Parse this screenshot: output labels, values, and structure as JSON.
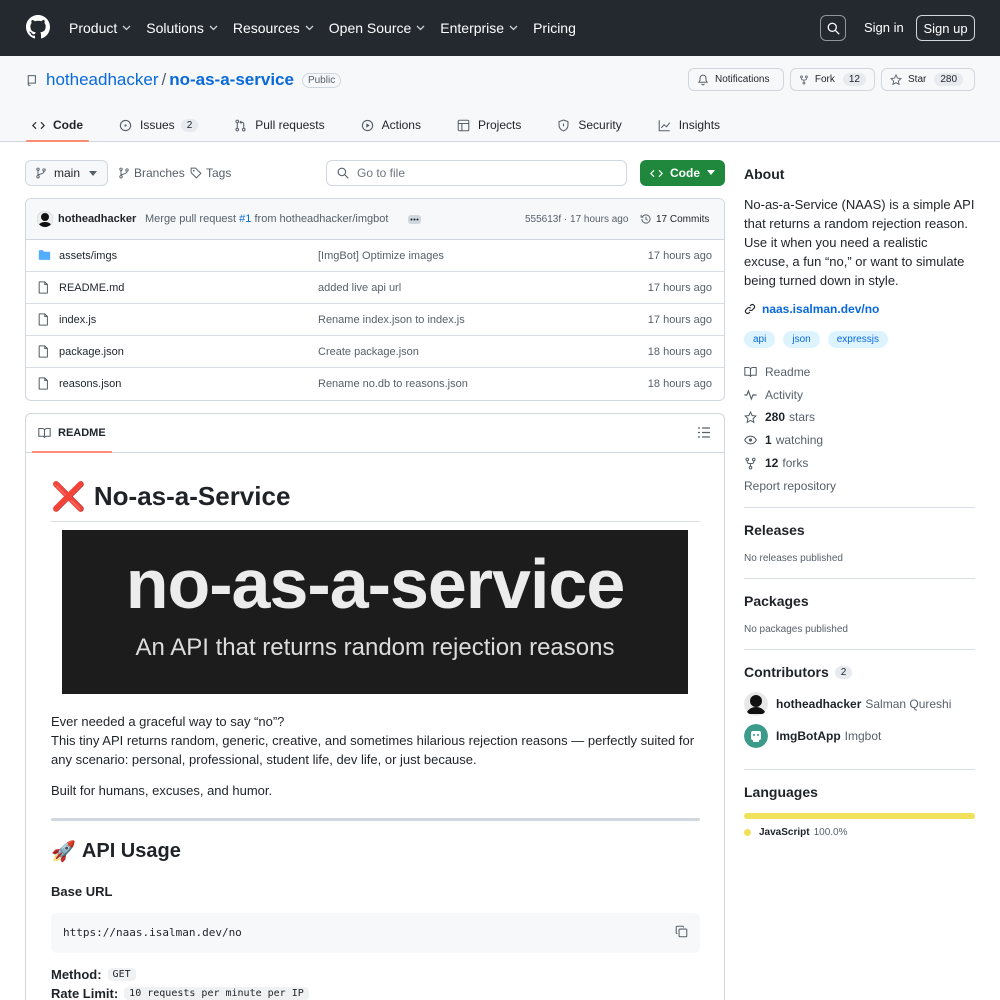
{
  "header": {
    "nav": [
      "Product",
      "Solutions",
      "Resources",
      "Open Source",
      "Enterprise",
      "Pricing"
    ],
    "signin": "Sign in",
    "signup": "Sign up"
  },
  "repo": {
    "owner": "hotheadhacker",
    "name": "no-as-a-service",
    "visibility": "Public",
    "notifications_label": "Notifications",
    "fork_label": "Fork",
    "fork_count": "12",
    "star_label": "Star",
    "star_count": "280",
    "tabs": [
      {
        "label": "Code",
        "count": ""
      },
      {
        "label": "Issues",
        "count": "2"
      },
      {
        "label": "Pull requests",
        "count": ""
      },
      {
        "label": "Actions",
        "count": ""
      },
      {
        "label": "Projects",
        "count": ""
      },
      {
        "label": "Security",
        "count": ""
      },
      {
        "label": "Insights",
        "count": ""
      }
    ]
  },
  "toolbar": {
    "branch": "main",
    "branches_label": "Branches",
    "tags_label": "Tags",
    "goto_placeholder": "Go to file",
    "code_label": "Code"
  },
  "commit": {
    "author": "hotheadhacker",
    "message_prefix": "Merge pull request ",
    "pr_ref": "#1",
    "message_suffix": " from hotheadhacker/imgbot",
    "hash_time": "555613f · 17 hours ago",
    "commits_label": "17 Commits"
  },
  "files": [
    {
      "name": "assets/imgs",
      "type": "folder",
      "message": "[ImgBot] Optimize images",
      "time": "17 hours ago"
    },
    {
      "name": "README.md",
      "type": "file",
      "message": "added live api url",
      "time": "17 hours ago"
    },
    {
      "name": "index.js",
      "type": "file",
      "message": "Rename index.json to index.js",
      "time": "17 hours ago"
    },
    {
      "name": "package.json",
      "type": "file",
      "message": "Create package.json",
      "time": "18 hours ago"
    },
    {
      "name": "reasons.json",
      "type": "file",
      "message": "Rename no.db to reasons.json",
      "time": "18 hours ago"
    }
  ],
  "readme": {
    "tab_label": "README",
    "h1_emoji": "❌",
    "h1": "No-as-a-Service",
    "banner_title": "no-as-a-service",
    "banner_subtitle": "An API that returns random rejection reasons",
    "p1_line1": "Ever needed a graceful way to say “no”?",
    "p1_line2": "This tiny API returns random, generic, creative, and sometimes hilarious rejection reasons — perfectly suited for any scenario: personal, professional, student life, dev life, or just because.",
    "p2": "Built for humans, excuses, and humor.",
    "h2_emoji": "🚀",
    "h2": "API Usage",
    "base_url_label": "Base URL",
    "base_url": "https://naas.isalman.dev/no",
    "method_label": "Method:",
    "method_value": "GET",
    "rate_label": "Rate Limit:",
    "rate_value": "10 requests per minute per IP"
  },
  "about": {
    "title": "About",
    "description": "No-as-a-Service (NAAS) is a simple API that returns a random rejection reason. Use it when you need a realistic excuse, a fun “no,” or want to simulate being turned down in style.",
    "link": "naas.isalman.dev/no",
    "topics": [
      "api",
      "json",
      "expressjs"
    ],
    "readme": "Readme",
    "activity": "Activity",
    "stars_count": "280",
    "stars_label": "stars",
    "watching_count": "1",
    "watching_label": "watching",
    "forks_count": "12",
    "forks_label": "forks",
    "report": "Report repository"
  },
  "releases": {
    "title": "Releases",
    "empty": "No releases published"
  },
  "packages": {
    "title": "Packages",
    "empty": "No packages published"
  },
  "contributors": {
    "title": "Contributors",
    "count": "2",
    "list": [
      {
        "login": "hotheadhacker",
        "name": "Salman Qureshi"
      },
      {
        "login": "ImgBotApp",
        "name": "Imgbot"
      }
    ]
  },
  "languages": {
    "title": "Languages",
    "items": [
      {
        "name": "JavaScript",
        "percent": "100.0%",
        "fraction": 1.0,
        "color": "#f1e05a"
      }
    ]
  },
  "colors": {
    "accent": "#0969da",
    "green": "#1f883d",
    "tab_underline": "#fd8c73",
    "header_bg": "#24292f"
  }
}
